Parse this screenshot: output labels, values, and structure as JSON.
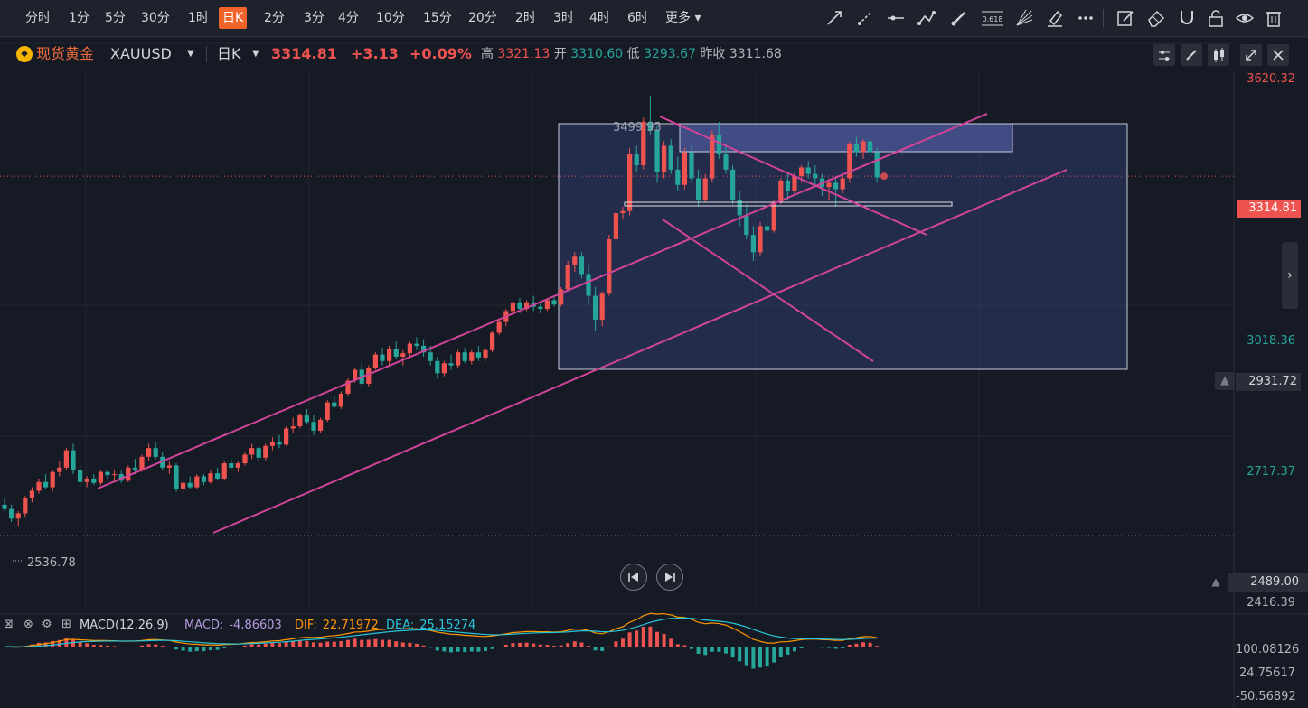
{
  "toolbar": {
    "timeframes": [
      {
        "label": "分时"
      },
      {
        "label": "1分"
      },
      {
        "label": "5分"
      },
      {
        "label": "30分"
      },
      {
        "label": "1时"
      },
      {
        "label": "日K",
        "active": true
      },
      {
        "label": "2分"
      },
      {
        "label": "3分"
      },
      {
        "label": "4分"
      },
      {
        "label": "10分"
      },
      {
        "label": "15分"
      },
      {
        "label": "20分"
      },
      {
        "label": "2时"
      },
      {
        "label": "3时"
      },
      {
        "label": "4时"
      },
      {
        "label": "6时"
      },
      {
        "label": "更多"
      }
    ],
    "fib_label": "0.618",
    "tools": [
      "trendline-icon",
      "ray-icon",
      "horizontal-line-icon",
      "polyline-icon",
      "brush-icon",
      "fibonacci-icon",
      "fan-icon",
      "highlighter-icon",
      "more-tools-icon",
      "edit-icon",
      "eraser-icon",
      "magnet-icon",
      "lock-icon",
      "eye-icon",
      "trash-icon"
    ]
  },
  "symbol": {
    "name": "现货黄金",
    "code": "XAUUSD",
    "interval": "日K",
    "price": "3314.81",
    "change": "+3.13",
    "change_pct": "+0.09%",
    "high_label": "高",
    "high": "3321.13",
    "open_label": "开",
    "open": "3310.60",
    "low_label": "低",
    "low": "3293.67",
    "prev_label": "昨收",
    "prev_close": "3311.68"
  },
  "price_axis": {
    "labels": [
      {
        "text": "3620.32",
        "v": 3620.32,
        "color": "#ef5350"
      },
      {
        "text": "3018.36",
        "v": 3018.36,
        "color": "#26a69a"
      },
      {
        "text": "2717.37",
        "v": 2717.37,
        "color": "#26a69a"
      },
      {
        "text": "2416.39",
        "v": 2416.39,
        "color": "#b2b5be"
      }
    ],
    "current": {
      "text": "3314.81",
      "v": 3314.81
    },
    "alert_1": {
      "text": "2931.72",
      "v": 2931.72
    },
    "alert_2": {
      "text": "2489.00",
      "v": 2489.0
    }
  },
  "chart_annotations": {
    "rect_top_label": "3499.93",
    "low_label": "2536.78"
  },
  "chart_data": {
    "type": "candlestick",
    "price_range": [
      2416.39,
      3620.32
    ],
    "candles": [
      [
        2560,
        2575,
        2545,
        2550
      ],
      [
        2550,
        2560,
        2520,
        2528
      ],
      [
        2528,
        2545,
        2510,
        2540
      ],
      [
        2540,
        2580,
        2530,
        2575
      ],
      [
        2575,
        2600,
        2565,
        2592
      ],
      [
        2592,
        2620,
        2585,
        2612
      ],
      [
        2612,
        2630,
        2595,
        2600
      ],
      [
        2600,
        2640,
        2590,
        2635
      ],
      [
        2635,
        2660,
        2625,
        2645
      ],
      [
        2645,
        2690,
        2640,
        2685
      ],
      [
        2685,
        2700,
        2630,
        2640
      ],
      [
        2640,
        2650,
        2600,
        2612
      ],
      [
        2612,
        2625,
        2600,
        2620
      ],
      [
        2620,
        2630,
        2605,
        2610
      ],
      [
        2610,
        2640,
        2605,
        2635
      ],
      [
        2635,
        2640,
        2620,
        2628
      ],
      [
        2628,
        2640,
        2615,
        2630
      ],
      [
        2630,
        2638,
        2610,
        2615
      ],
      [
        2615,
        2650,
        2612,
        2645
      ],
      [
        2645,
        2665,
        2630,
        2640
      ],
      [
        2640,
        2675,
        2635,
        2670
      ],
      [
        2670,
        2700,
        2660,
        2690
      ],
      [
        2690,
        2705,
        2665,
        2670
      ],
      [
        2670,
        2680,
        2640,
        2645
      ],
      [
        2645,
        2660,
        2630,
        2650
      ],
      [
        2650,
        2655,
        2590,
        2595
      ],
      [
        2595,
        2615,
        2585,
        2610
      ],
      [
        2610,
        2625,
        2595,
        2600
      ],
      [
        2600,
        2630,
        2596,
        2625
      ],
      [
        2625,
        2630,
        2605,
        2612
      ],
      [
        2612,
        2640,
        2608,
        2632
      ],
      [
        2632,
        2645,
        2615,
        2620
      ],
      [
        2620,
        2660,
        2615,
        2655
      ],
      [
        2655,
        2665,
        2640,
        2645
      ],
      [
        2645,
        2660,
        2635,
        2655
      ],
      [
        2655,
        2680,
        2650,
        2675
      ],
      [
        2675,
        2700,
        2665,
        2690
      ],
      [
        2690,
        2695,
        2660,
        2668
      ],
      [
        2668,
        2700,
        2662,
        2695
      ],
      [
        2695,
        2715,
        2685,
        2705
      ],
      [
        2705,
        2720,
        2690,
        2698
      ],
      [
        2698,
        2740,
        2695,
        2735
      ],
      [
        2735,
        2760,
        2725,
        2740
      ],
      [
        2740,
        2770,
        2735,
        2765
      ],
      [
        2765,
        2780,
        2745,
        2750
      ],
      [
        2750,
        2765,
        2720,
        2730
      ],
      [
        2730,
        2760,
        2725,
        2755
      ],
      [
        2755,
        2800,
        2750,
        2795
      ],
      [
        2795,
        2810,
        2780,
        2785
      ],
      [
        2785,
        2820,
        2780,
        2815
      ],
      [
        2815,
        2850,
        2810,
        2845
      ],
      [
        2845,
        2875,
        2840,
        2870
      ],
      [
        2870,
        2885,
        2830,
        2838
      ],
      [
        2838,
        2880,
        2832,
        2875
      ],
      [
        2875,
        2910,
        2870,
        2905
      ],
      [
        2905,
        2920,
        2880,
        2890
      ],
      [
        2890,
        2925,
        2880,
        2918
      ],
      [
        2918,
        2935,
        2895,
        2900
      ],
      [
        2900,
        2915,
        2880,
        2908
      ],
      [
        2908,
        2935,
        2900,
        2930
      ],
      [
        2930,
        2945,
        2915,
        2925
      ],
      [
        2925,
        2940,
        2900,
        2910
      ],
      [
        2910,
        2925,
        2880,
        2890
      ],
      [
        2890,
        2900,
        2850,
        2862
      ],
      [
        2862,
        2890,
        2855,
        2885
      ],
      [
        2885,
        2905,
        2870,
        2880
      ],
      [
        2880,
        2915,
        2875,
        2910
      ],
      [
        2910,
        2920,
        2885,
        2890
      ],
      [
        2890,
        2915,
        2882,
        2910
      ],
      [
        2910,
        2925,
        2890,
        2898
      ],
      [
        2898,
        2920,
        2890,
        2915
      ],
      [
        2915,
        2960,
        2910,
        2955
      ],
      [
        2955,
        2985,
        2950,
        2980
      ],
      [
        2980,
        3010,
        2970,
        3005
      ],
      [
        3005,
        3030,
        2995,
        3025
      ],
      [
        3025,
        3035,
        3000,
        3010
      ],
      [
        3010,
        3030,
        3005,
        3025
      ],
      [
        3025,
        3040,
        3005,
        3015
      ],
      [
        3015,
        3025,
        3000,
        3010
      ],
      [
        3010,
        3035,
        3005,
        3030
      ],
      [
        3030,
        3040,
        3015,
        3020
      ],
      [
        3020,
        3060,
        3015,
        3055
      ],
      [
        3055,
        3120,
        3050,
        3110
      ],
      [
        3110,
        3140,
        3095,
        3130
      ],
      [
        3130,
        3140,
        3080,
        3090
      ],
      [
        3090,
        3110,
        3020,
        3040
      ],
      [
        3040,
        3060,
        2960,
        2985
      ],
      [
        2985,
        3050,
        2970,
        3045
      ],
      [
        3045,
        3180,
        3040,
        3170
      ],
      [
        3170,
        3240,
        3160,
        3230
      ],
      [
        3230,
        3245,
        3215,
        3235
      ],
      [
        3235,
        3380,
        3225,
        3365
      ],
      [
        3365,
        3385,
        3325,
        3340
      ],
      [
        3340,
        3450,
        3330,
        3440
      ],
      [
        3440,
        3500,
        3410,
        3420
      ],
      [
        3420,
        3430,
        3300,
        3325
      ],
      [
        3325,
        3395,
        3310,
        3385
      ],
      [
        3385,
        3400,
        3320,
        3330
      ],
      [
        3330,
        3360,
        3280,
        3295
      ],
      [
        3295,
        3380,
        3285,
        3370
      ],
      [
        3370,
        3385,
        3300,
        3310
      ],
      [
        3310,
        3330,
        3245,
        3260
      ],
      [
        3260,
        3320,
        3255,
        3310
      ],
      [
        3310,
        3420,
        3300,
        3410
      ],
      [
        3410,
        3440,
        3355,
        3365
      ],
      [
        3365,
        3390,
        3320,
        3330
      ],
      [
        3330,
        3340,
        3250,
        3260
      ],
      [
        3260,
        3280,
        3200,
        3225
      ],
      [
        3225,
        3250,
        3170,
        3180
      ],
      [
        3180,
        3200,
        3120,
        3140
      ],
      [
        3140,
        3210,
        3130,
        3200
      ],
      [
        3200,
        3230,
        3180,
        3190
      ],
      [
        3190,
        3260,
        3185,
        3255
      ],
      [
        3255,
        3310,
        3250,
        3305
      ],
      [
        3305,
        3320,
        3260,
        3280
      ],
      [
        3280,
        3325,
        3270,
        3315
      ],
      [
        3315,
        3340,
        3300,
        3335
      ],
      [
        3335,
        3350,
        3310,
        3320
      ],
      [
        3320,
        3340,
        3295,
        3310
      ],
      [
        3310,
        3320,
        3270,
        3290
      ],
      [
        3290,
        3310,
        3260,
        3300
      ],
      [
        3300,
        3310,
        3245,
        3285
      ],
      [
        3285,
        3320,
        3275,
        3310
      ],
      [
        3310,
        3395,
        3300,
        3390
      ],
      [
        3390,
        3405,
        3360,
        3370
      ],
      [
        3370,
        3400,
        3355,
        3395
      ],
      [
        3395,
        3410,
        3360,
        3370
      ],
      [
        3370,
        3380,
        3300,
        3312
      ]
    ],
    "macd": {
      "params": "MACD(12,26,9)",
      "macd_label": "MACD:",
      "macd": "-4.86603",
      "dif_label": "DIF:",
      "dif": "22.71972",
      "dea_label": "DEA:",
      "dea": "25.15274",
      "axis": [
        {
          "text": "100.08126",
          "v": 100.08126
        },
        {
          "text": "24.75617",
          "v": 24.75617
        },
        {
          "text": "-50.56892",
          "v": -50.56892
        }
      ]
    }
  }
}
